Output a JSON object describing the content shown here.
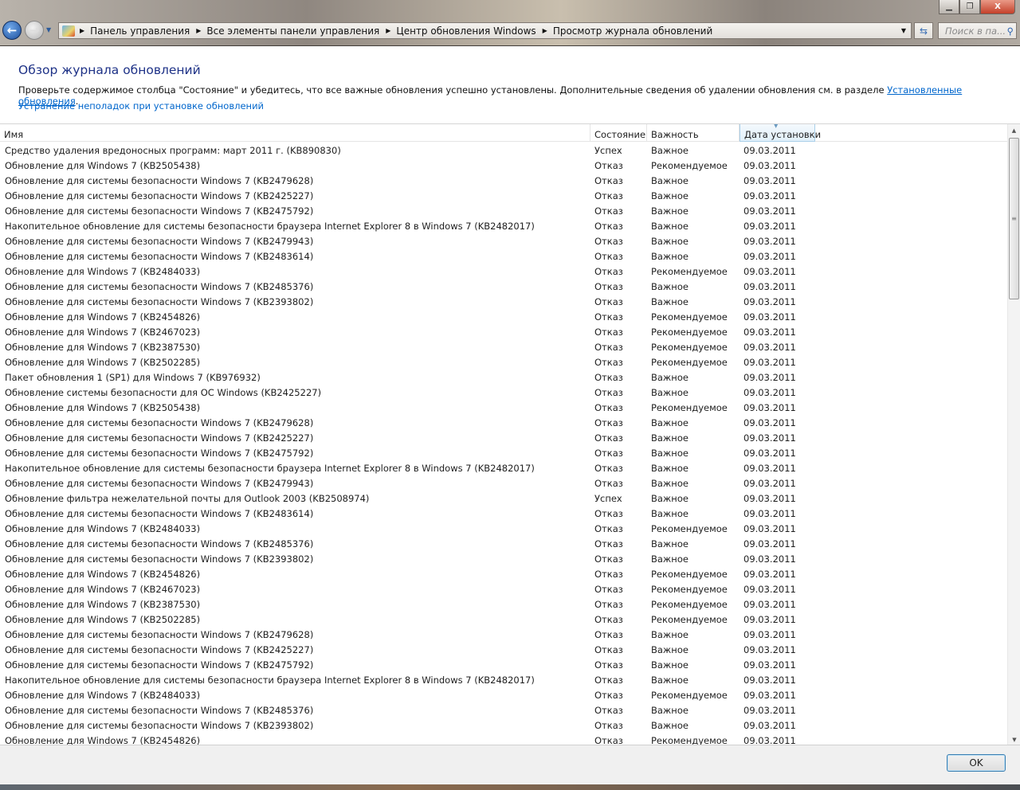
{
  "window": {
    "minimize": "▁",
    "restore": "❐",
    "close": "X"
  },
  "address_bar": {
    "breadcrumbs": [
      "Панель управления",
      "Все элементы панели управления",
      "Центр обновления Windows",
      "Просмотр журнала обновлений"
    ],
    "search_placeholder": "Поиск в па..."
  },
  "page": {
    "title": "Обзор журнала обновлений",
    "description": "Проверьте содержимое столбца \"Состояние\" и убедитесь, что все важные обновления успешно установлены. Дополнительные сведения об удалении обновления см. в разделе ",
    "description_link": "Установленные обновления",
    "description_end": ".",
    "troubleshoot_link": "Устранение неполадок при установке обновлений"
  },
  "table": {
    "columns": [
      "Имя",
      "Состояние",
      "Важность",
      "Дата установки"
    ],
    "rows": [
      [
        "Средство удаления вредоносных программ: март 2011 г. (KB890830)",
        "Успех",
        "Важное",
        "09.03.2011"
      ],
      [
        "Обновление для Windows 7 (KB2505438)",
        "Отказ",
        "Рекомендуемое",
        "09.03.2011"
      ],
      [
        "Обновление для системы безопасности Windows 7 (KB2479628)",
        "Отказ",
        "Важное",
        "09.03.2011"
      ],
      [
        "Обновление для системы безопасности Windows 7 (KB2425227)",
        "Отказ",
        "Важное",
        "09.03.2011"
      ],
      [
        "Обновление для системы безопасности Windows 7 (KB2475792)",
        "Отказ",
        "Важное",
        "09.03.2011"
      ],
      [
        "Накопительное обновление для системы безопасности браузера Internet Explorer 8 в Windows 7 (KB2482017)",
        "Отказ",
        "Важное",
        "09.03.2011"
      ],
      [
        "Обновление для системы безопасности Windows 7 (KB2479943)",
        "Отказ",
        "Важное",
        "09.03.2011"
      ],
      [
        "Обновление для системы безопасности Windows 7 (KB2483614)",
        "Отказ",
        "Важное",
        "09.03.2011"
      ],
      [
        "Обновление для Windows 7 (KB2484033)",
        "Отказ",
        "Рекомендуемое",
        "09.03.2011"
      ],
      [
        "Обновление для системы безопасности Windows 7 (KB2485376)",
        "Отказ",
        "Важное",
        "09.03.2011"
      ],
      [
        "Обновление для системы безопасности Windows 7 (KB2393802)",
        "Отказ",
        "Важное",
        "09.03.2011"
      ],
      [
        "Обновление для Windows 7 (KB2454826)",
        "Отказ",
        "Рекомендуемое",
        "09.03.2011"
      ],
      [
        "Обновление для Windows 7 (KB2467023)",
        "Отказ",
        "Рекомендуемое",
        "09.03.2011"
      ],
      [
        "Обновление для Windows 7 (KB2387530)",
        "Отказ",
        "Рекомендуемое",
        "09.03.2011"
      ],
      [
        "Обновление для Windows 7 (KB2502285)",
        "Отказ",
        "Рекомендуемое",
        "09.03.2011"
      ],
      [
        "Пакет обновления 1 (SP1) для Windows 7 (KB976932)",
        "Отказ",
        "Важное",
        "09.03.2011"
      ],
      [
        "Обновление системы безопасности для ОС Windows (KB2425227)",
        "Отказ",
        "Важное",
        "09.03.2011"
      ],
      [
        "Обновление для Windows 7 (KB2505438)",
        "Отказ",
        "Рекомендуемое",
        "09.03.2011"
      ],
      [
        "Обновление для системы безопасности Windows 7 (KB2479628)",
        "Отказ",
        "Важное",
        "09.03.2011"
      ],
      [
        "Обновление для системы безопасности Windows 7 (KB2425227)",
        "Отказ",
        "Важное",
        "09.03.2011"
      ],
      [
        "Обновление для системы безопасности Windows 7 (KB2475792)",
        "Отказ",
        "Важное",
        "09.03.2011"
      ],
      [
        "Накопительное обновление для системы безопасности браузера Internet Explorer 8 в Windows 7 (KB2482017)",
        "Отказ",
        "Важное",
        "09.03.2011"
      ],
      [
        "Обновление для системы безопасности Windows 7 (KB2479943)",
        "Отказ",
        "Важное",
        "09.03.2011"
      ],
      [
        "Обновление фильтра нежелательной почты для Outlook 2003 (KB2508974)",
        "Успех",
        "Важное",
        "09.03.2011"
      ],
      [
        "Обновление для системы безопасности Windows 7 (KB2483614)",
        "Отказ",
        "Важное",
        "09.03.2011"
      ],
      [
        "Обновление для Windows 7 (KB2484033)",
        "Отказ",
        "Рекомендуемое",
        "09.03.2011"
      ],
      [
        "Обновление для системы безопасности Windows 7 (KB2485376)",
        "Отказ",
        "Важное",
        "09.03.2011"
      ],
      [
        "Обновление для системы безопасности Windows 7 (KB2393802)",
        "Отказ",
        "Важное",
        "09.03.2011"
      ],
      [
        "Обновление для Windows 7 (KB2454826)",
        "Отказ",
        "Рекомендуемое",
        "09.03.2011"
      ],
      [
        "Обновление для Windows 7 (KB2467023)",
        "Отказ",
        "Рекомендуемое",
        "09.03.2011"
      ],
      [
        "Обновление для Windows 7 (KB2387530)",
        "Отказ",
        "Рекомендуемое",
        "09.03.2011"
      ],
      [
        "Обновление для Windows 7 (KB2502285)",
        "Отказ",
        "Рекомендуемое",
        "09.03.2011"
      ],
      [
        "Обновление для системы безопасности Windows 7 (KB2479628)",
        "Отказ",
        "Важное",
        "09.03.2011"
      ],
      [
        "Обновление для системы безопасности Windows 7 (KB2425227)",
        "Отказ",
        "Важное",
        "09.03.2011"
      ],
      [
        "Обновление для системы безопасности Windows 7 (KB2475792)",
        "Отказ",
        "Важное",
        "09.03.2011"
      ],
      [
        "Накопительное обновление для системы безопасности браузера Internet Explorer 8 в Windows 7 (KB2482017)",
        "Отказ",
        "Важное",
        "09.03.2011"
      ],
      [
        "Обновление для Windows 7 (KB2484033)",
        "Отказ",
        "Рекомендуемое",
        "09.03.2011"
      ],
      [
        "Обновление для системы безопасности Windows 7 (KB2485376)",
        "Отказ",
        "Важное",
        "09.03.2011"
      ],
      [
        "Обновление для системы безопасности Windows 7 (KB2393802)",
        "Отказ",
        "Важное",
        "09.03.2011"
      ],
      [
        "Обновление для Windows 7 (KB2454826)",
        "Отказ",
        "Рекомендуемое",
        "09.03.2011"
      ]
    ]
  },
  "footer": {
    "ok_label": "OK"
  }
}
